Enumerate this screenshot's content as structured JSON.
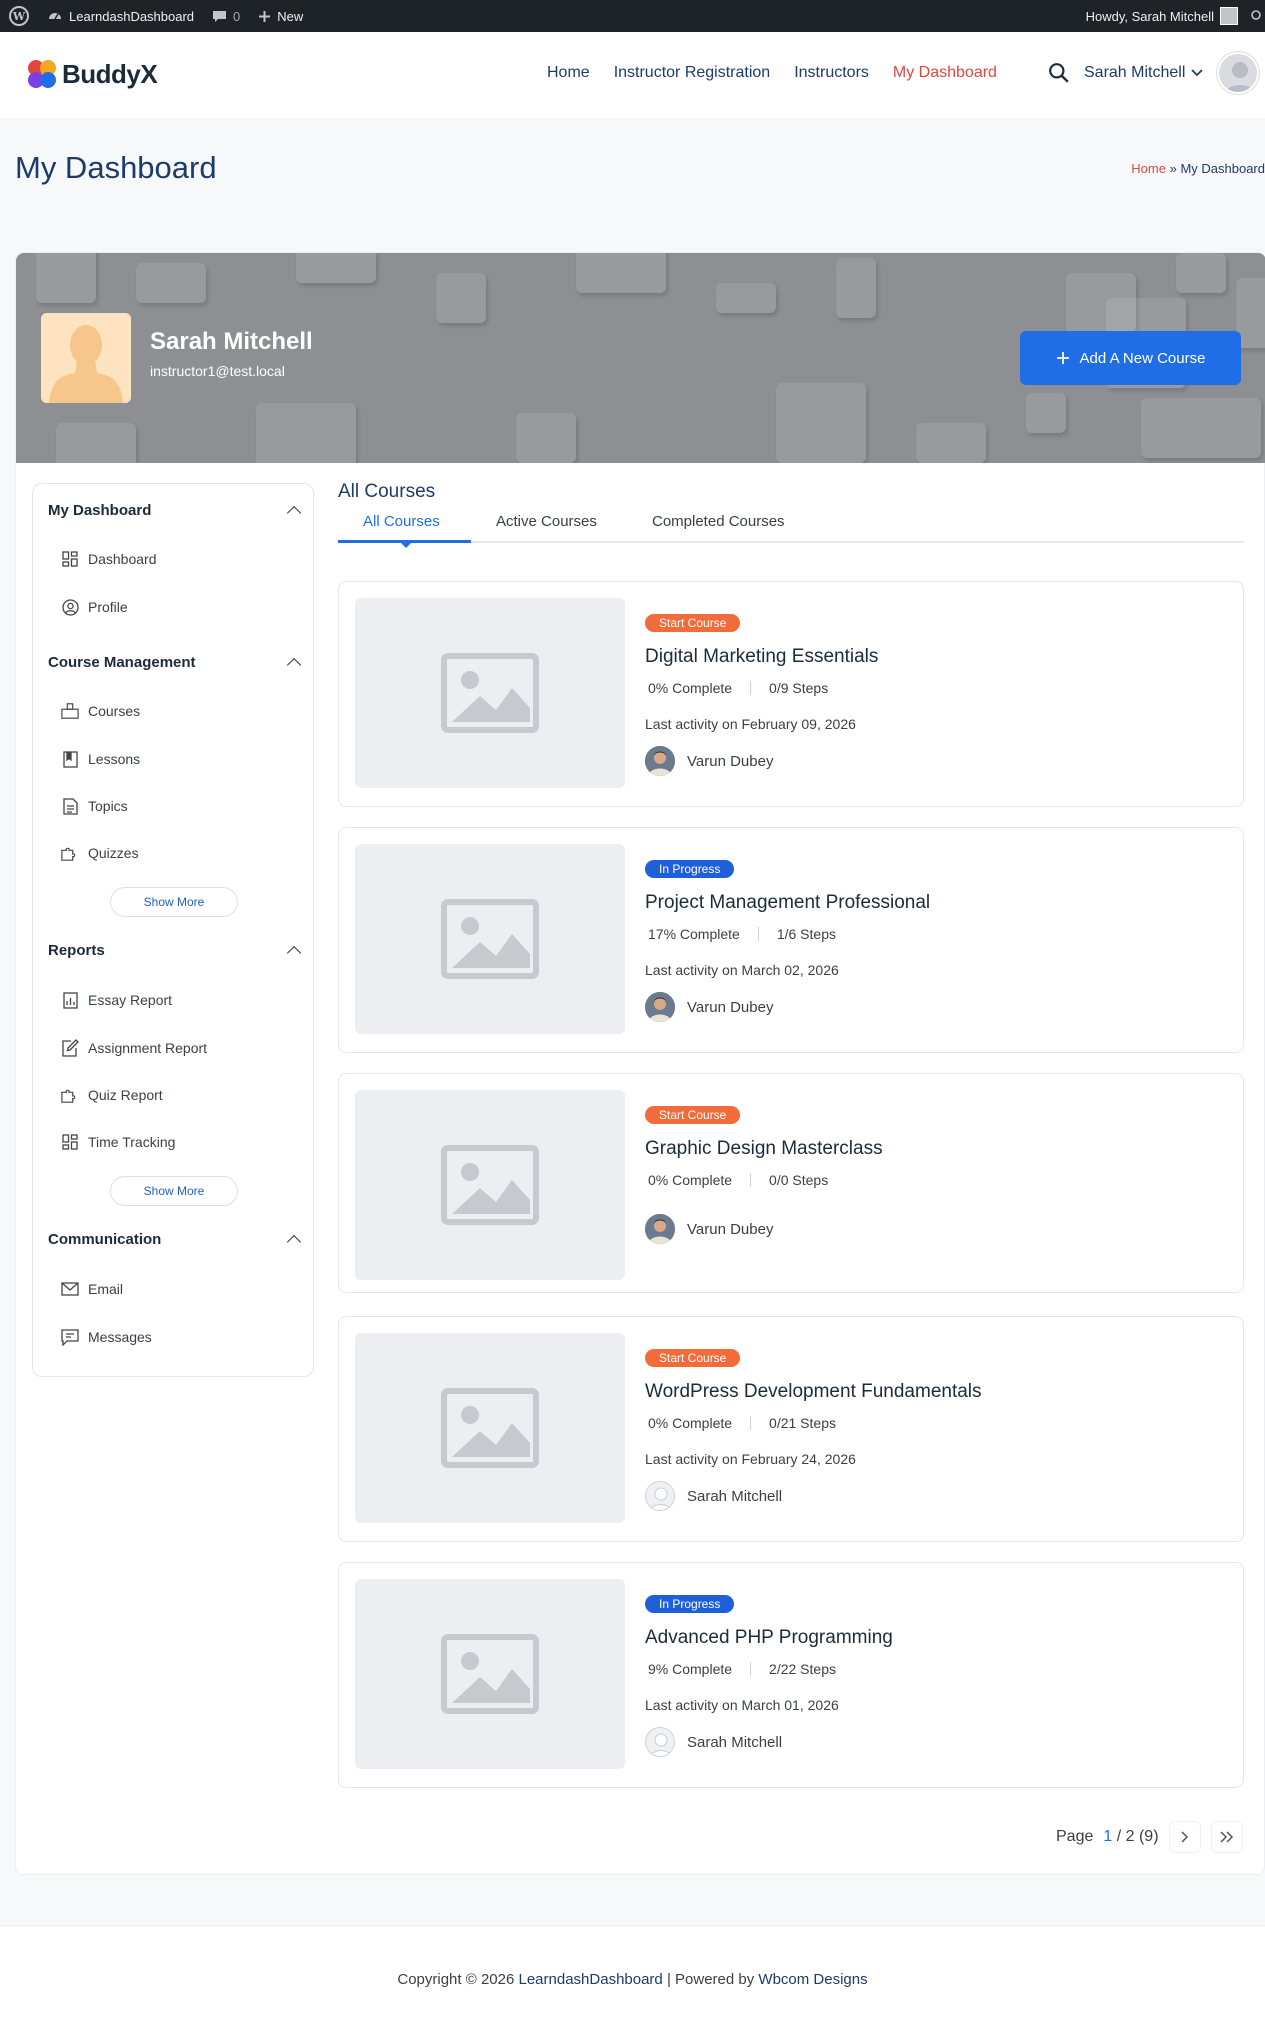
{
  "admin_bar": {
    "site_name": "LearndashDashboard",
    "comments_count": "0",
    "new_label": "New",
    "howdy": "Howdy, Sarah Mitchell"
  },
  "header": {
    "logo_text": "BuddyX",
    "nav": [
      "Home",
      "Instructor Registration",
      "Instructors",
      "My Dashboard"
    ],
    "active_nav": "My Dashboard",
    "user_name": "Sarah Mitchell"
  },
  "page": {
    "title": "My Dashboard",
    "breadcrumb_home": "Home",
    "breadcrumb_sep": "»",
    "breadcrumb_current": "My Dashboard"
  },
  "profile": {
    "name": "Sarah Mitchell",
    "email": "instructor1@test.local",
    "add_course_label": "Add A New Course"
  },
  "sidebar": {
    "sections": [
      {
        "title": "My Dashboard",
        "items": [
          "Dashboard",
          "Profile"
        ]
      },
      {
        "title": "Course Management",
        "items": [
          "Courses",
          "Lessons",
          "Topics",
          "Quizzes"
        ],
        "show_more": "Show More"
      },
      {
        "title": "Reports",
        "items": [
          "Essay Report",
          "Assignment Report",
          "Quiz Report",
          "Time Tracking"
        ],
        "show_more": "Show More"
      },
      {
        "title": "Communication",
        "items": [
          "Email",
          "Messages"
        ]
      }
    ]
  },
  "courses": {
    "heading": "All Courses",
    "tabs": [
      "All Courses",
      "Active Courses",
      "Completed Courses"
    ],
    "active_tab": "All Courses",
    "list": [
      {
        "badge": "Start Course",
        "status": "start",
        "title": "Digital Marketing Essentials",
        "complete": "0% Complete",
        "steps": "0/9 Steps",
        "activity": "Last activity on February 09, 2026",
        "author": "Varun Dubey",
        "author_avatar": "photo"
      },
      {
        "badge": "In Progress",
        "status": "progress",
        "title": "Project Management Professional",
        "complete": "17% Complete",
        "steps": "1/6 Steps",
        "activity": "Last activity on March 02, 2026",
        "author": "Varun Dubey",
        "author_avatar": "photo"
      },
      {
        "badge": "Start Course",
        "status": "start",
        "title": "Graphic Design Masterclass",
        "complete": "0% Complete",
        "steps": "0/0 Steps",
        "activity": "",
        "author": "Varun Dubey",
        "author_avatar": "photo"
      },
      {
        "badge": "Start Course",
        "status": "start",
        "title": "WordPress Development Fundamentals",
        "complete": "0% Complete",
        "steps": "0/21 Steps",
        "activity": "Last activity on February 24, 2026",
        "author": "Sarah Mitchell",
        "author_avatar": "blank"
      },
      {
        "badge": "In Progress",
        "status": "progress",
        "title": "Advanced PHP Programming",
        "complete": "9% Complete",
        "steps": "2/22 Steps",
        "activity": "Last activity on March 01, 2026",
        "author": "Sarah Mitchell",
        "author_avatar": "blank"
      }
    ]
  },
  "pagination": {
    "prefix": "Page",
    "current": "1",
    "rest": "/ 2 (9)"
  },
  "footer": {
    "prefix": "Copyright © 2026",
    "site_link": "LearndashDashboard",
    "middle": "| Powered by",
    "powered_link": "Wbcom Designs"
  },
  "colors": {
    "accent": "#1f6ee8",
    "active_nav": "#e0473e",
    "badge_start": "#f26b3a",
    "badge_progress": "#1f5fd9"
  }
}
